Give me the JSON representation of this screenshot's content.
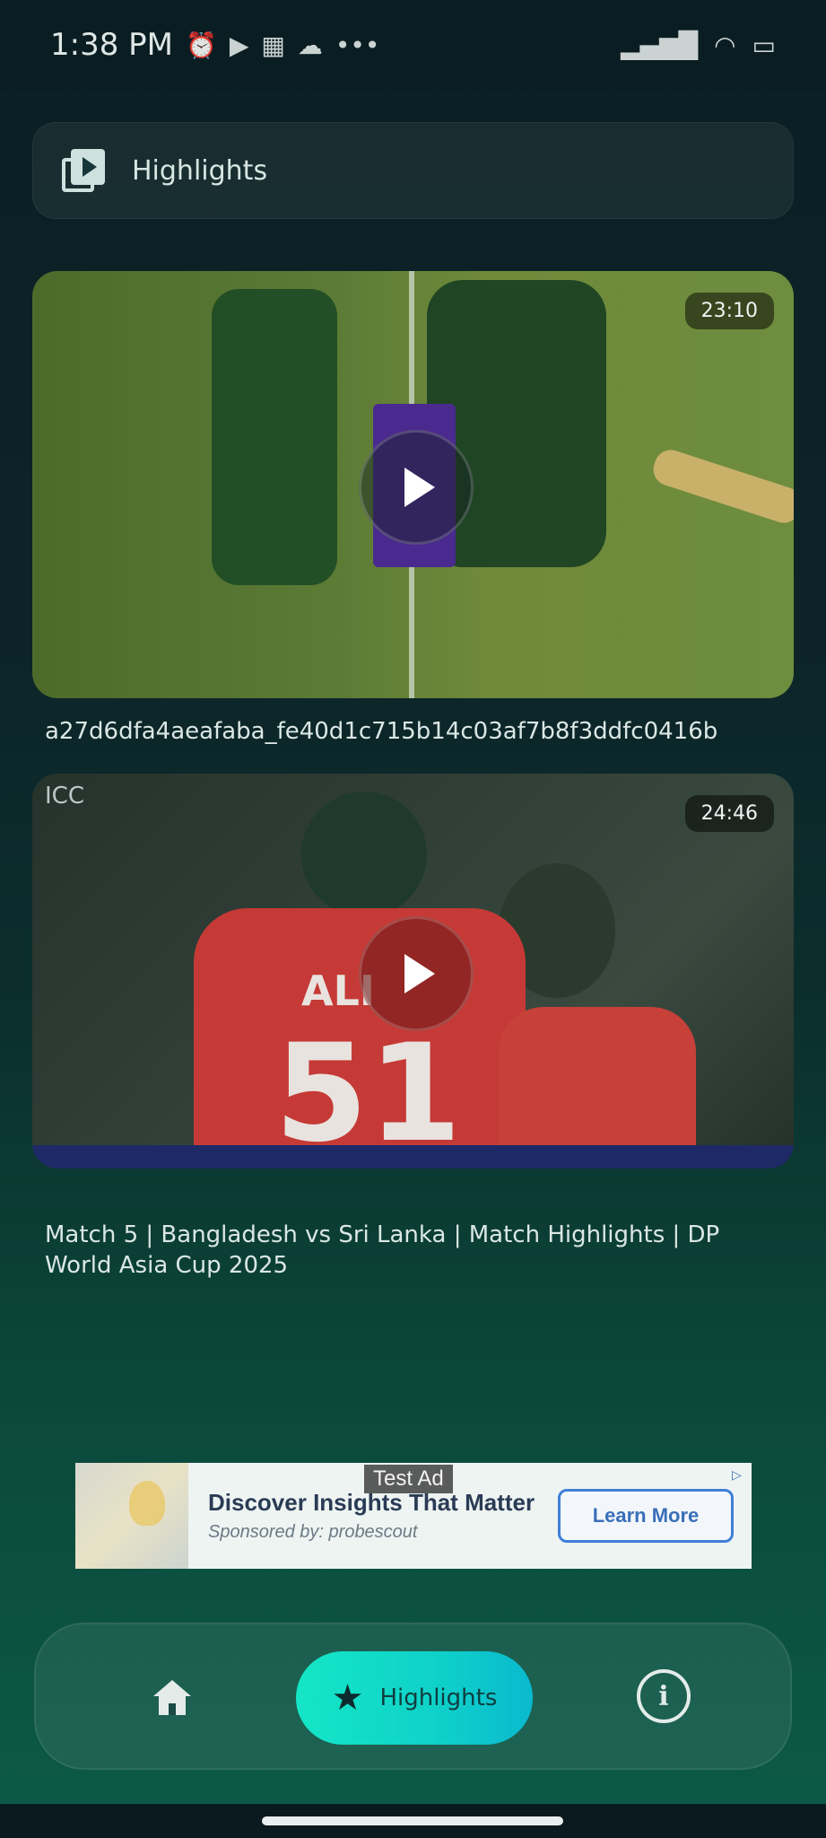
{
  "status_bar": {
    "time": "1:38 PM",
    "left_icons": [
      "alarm-icon",
      "youtube-icon",
      "app-grid-icon",
      "cloud-icon",
      "more-dots-icon"
    ],
    "right_icons": [
      "signal-icon",
      "wifi-icon",
      "battery-icon"
    ],
    "more": "•••"
  },
  "header": {
    "title": "Highlights",
    "icon": "video-library-icon"
  },
  "videos": [
    {
      "duration": "23:10",
      "title": "a27d6dfa4aeafaba_fe40d1c715b14c03af7b8f3ddfc0416b"
    },
    {
      "duration": "24:46",
      "title": "Match 5  |  Bangladesh vs Sri Lanka  |  Match Highlights  |  DP World Asia Cup 2025",
      "jersey_name": "ALI",
      "jersey_number": "51",
      "corner_logo": "ICC"
    }
  ],
  "ad": {
    "label": "Test Ad",
    "headline": "Discover Insights That Matter",
    "sponsor": "Sponsored by: probescout",
    "cta": "Learn More"
  },
  "bottom_nav": {
    "items": [
      {
        "icon": "home-icon",
        "label": ""
      },
      {
        "icon": "star-icon",
        "label": "Highlights",
        "active": true
      },
      {
        "icon": "info-icon",
        "label": ""
      }
    ]
  },
  "colors": {
    "accent": "#15e6c6",
    "background_top": "#0b1f24",
    "background_bottom": "#0c5a48"
  }
}
